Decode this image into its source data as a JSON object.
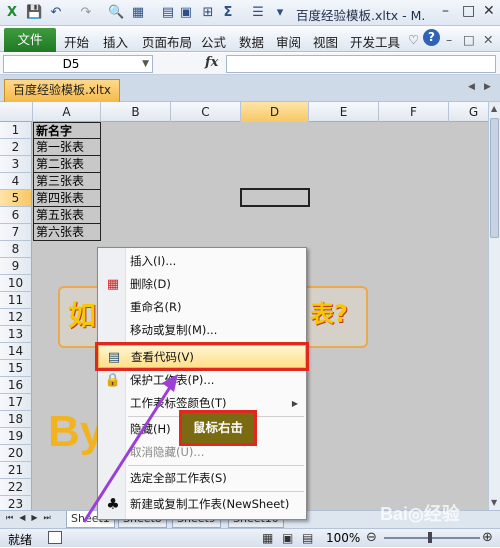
{
  "window": {
    "title": "百度经验模板.xltx - M.",
    "controls": {
      "minimize": "–",
      "restore": "□",
      "close": "✕"
    }
  },
  "ribbon": {
    "file_tab": "文件",
    "tabs": [
      "开始",
      "插入",
      "页面布局",
      "公式",
      "数据",
      "审阅",
      "视图",
      "开发工具"
    ]
  },
  "formula_bar": {
    "name_box": "D5",
    "fx": "fx",
    "value": ""
  },
  "document_tab": "百度经验模板.xltx",
  "columns": [
    "A",
    "B",
    "C",
    "D",
    "E",
    "F",
    "G"
  ],
  "rows": [
    "1",
    "2",
    "3",
    "4",
    "5",
    "6",
    "7",
    "8",
    "9",
    "10",
    "11",
    "12",
    "13",
    "14",
    "15",
    "16",
    "17",
    "18",
    "19",
    "20",
    "21",
    "22",
    "23"
  ],
  "column_a_cells": [
    "新名字",
    "第一张表",
    "第二张表",
    "第三张表",
    "第四张表",
    "第五张表",
    "第六张表"
  ],
  "background_text": {
    "left": "如",
    "right": "表?",
    "big": "By"
  },
  "context_menu": {
    "items": [
      {
        "label": "插入(I)...",
        "icon": "insert-icon",
        "disabled": false
      },
      {
        "label": "删除(D)",
        "icon": "delete-icon",
        "disabled": false
      },
      {
        "label": "重命名(R)",
        "icon": "",
        "disabled": false
      },
      {
        "label": "移动或复制(M)...",
        "icon": "",
        "disabled": false
      },
      {
        "label": "查看代码(V)",
        "icon": "view-code-icon",
        "disabled": false
      },
      {
        "label": "保护工作表(P)...",
        "icon": "protect-sheet-icon",
        "disabled": false
      },
      {
        "label": "工作表标签颜色(T)",
        "icon": "",
        "disabled": false
      },
      {
        "label": "隐藏(H)",
        "icon": "",
        "disabled": false
      },
      {
        "label": "取消隐藏(U)...",
        "icon": "",
        "disabled": true
      },
      {
        "label": "选定全部工作表(S)",
        "icon": "",
        "disabled": false
      },
      {
        "label": "新建或复制工作表(NewSheet)",
        "icon": "club-icon",
        "disabled": false
      }
    ]
  },
  "callout": {
    "text": "鼠标右击",
    "bg": "#7a6a12",
    "border": "#e0281e"
  },
  "sheet_tabs": [
    "Sheet1",
    "Sheet8",
    "Sheet9",
    "Sheet10"
  ],
  "status_bar": {
    "ready": "就绪",
    "zoom": "100%"
  },
  "colors": {
    "highlight": "#e0281e",
    "arrow": "#9b3fd6",
    "grid_bg": "#c8c8c8",
    "file_tab": "#2a7f2e"
  }
}
